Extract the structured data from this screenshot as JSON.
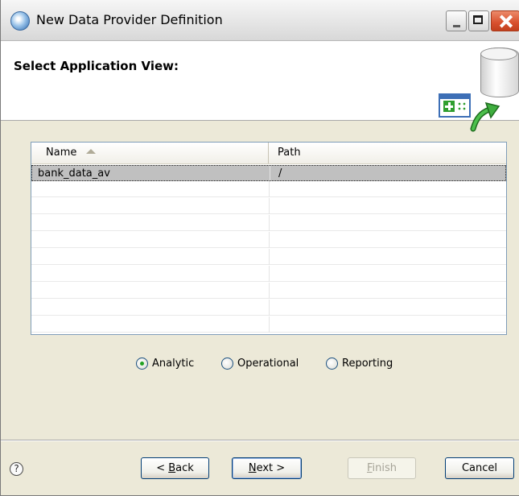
{
  "window": {
    "title": "New Data Provider Definition"
  },
  "banner": {
    "title": "Select Application View:"
  },
  "table": {
    "columns": [
      "Name",
      "Path"
    ],
    "sort_indicator": "ascending",
    "rows": [
      {
        "name": "bank_data_av",
        "path": "/",
        "selected": true
      }
    ]
  },
  "view_type": {
    "options": [
      "Analytic",
      "Operational",
      "Reporting"
    ],
    "selected": "Analytic"
  },
  "buttons": {
    "back_prefix": "< ",
    "back_mnemonic": "B",
    "back_rest": "ack",
    "next_mnemonic": "N",
    "next_rest": "ext >",
    "finish_mnemonic": "F",
    "finish_rest": "inish",
    "cancel": "Cancel"
  },
  "help": {
    "glyph": "?"
  },
  "icons": {
    "app": "globe-icon",
    "banner": "database-wizard-icon",
    "help": "help-icon"
  },
  "colors": {
    "selection": "#c0c0c0",
    "radio_dot": "#21a121",
    "close_button": "#d8502e",
    "border_blue": "#003c74"
  }
}
